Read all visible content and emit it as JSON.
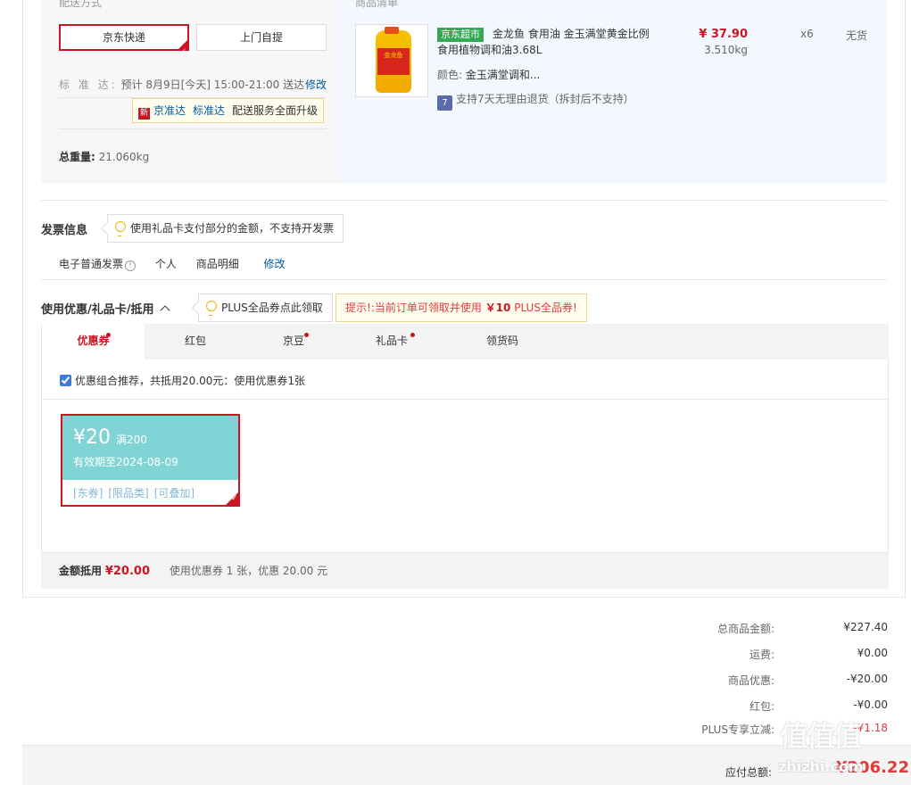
{
  "shipping": {
    "header_fragment_left": "配送方式",
    "header_fragment_right": "商品清单",
    "express_label": "京东快递",
    "pickup_label": "上门自提",
    "standard_label": "标 准 达:",
    "standard_text": "预计 8月9日[今天] 15:00-21:00 送达",
    "modify_label": "修改",
    "tip_new": "新",
    "tip_jzd": "京准达",
    "tip_bzd": "标准达",
    "tip_text": "配送服务全面升级",
    "weight_label": "总重量:",
    "weight_value": "21.060kg"
  },
  "product": {
    "badge": "京东超市",
    "name": "金龙鱼 食用油 金玉满堂黄金比例食用植物调和油3.68L",
    "color_label": "颜色:",
    "color_value": "金玉满堂调和...",
    "return_icon": "7",
    "return_text": "支持7天无理由退货（拆封后不支持）",
    "price": "¥ 37.90",
    "weight": "3.510kg",
    "qty": "x6",
    "stock": "无货",
    "image_label": "金龙鱼"
  },
  "invoice": {
    "title": "发票信息",
    "tip": "使用礼品卡支付部分的金额，不支持开发票",
    "type": "电子普通发票",
    "info_icon": "!",
    "person": "个人",
    "detail": "商品明细",
    "modify": "修改"
  },
  "coupons": {
    "title": "使用优惠/礼品卡/抵用",
    "plus_tip": "PLUS全品券点此领取",
    "hint_prefix": "提示!:当前订单可领取并使用",
    "hint_amount": "￥10",
    "hint_suffix": "PLUS全品券!",
    "tabs": [
      {
        "label": "优惠券"
      },
      {
        "label": "红包"
      },
      {
        "label": "京豆"
      },
      {
        "label": "礼品卡"
      },
      {
        "label": "领货码"
      }
    ],
    "combo_text": "优惠组合推荐，共抵用20.00元：使用优惠券1张",
    "coupon": {
      "amount": "¥20",
      "threshold": "满200",
      "expiry": "有效期至2024-08-09",
      "tags": [
        "[东券]",
        "[限品类]",
        "[可叠加]"
      ]
    },
    "summary_label": "金额抵用",
    "summary_amount": "¥20.00",
    "summary_text": "使用优惠券 1 张，优惠 20.00 元"
  },
  "totals": {
    "rows": [
      {
        "label": "总商品金额:",
        "value": "¥227.40"
      },
      {
        "label": "运费:",
        "value": "¥0.00"
      },
      {
        "label": "商品优惠:",
        "value": "-¥20.00"
      },
      {
        "label": "红包:",
        "value": "-¥0.00"
      },
      {
        "label": "PLUS专享立减:",
        "value": "-¥1.18"
      }
    ],
    "pay_label": "应付总额:",
    "pay_value": "¥206.22"
  },
  "watermark": {
    "glyphs": "值值值",
    "text": "zhizhi.com"
  },
  "colors": {
    "accent_red": "#c81623",
    "link_blue": "#005aa0",
    "coupon_teal": "#81d4d6",
    "supermarket_green": "#33a954"
  }
}
